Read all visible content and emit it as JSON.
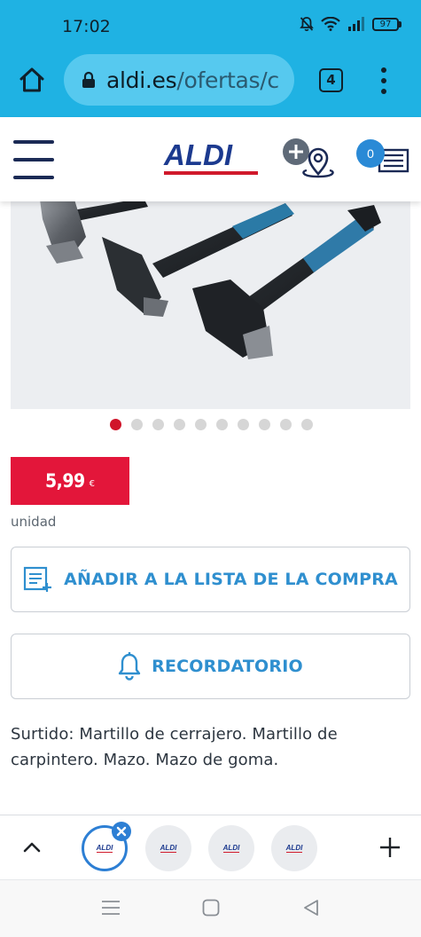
{
  "status_bar": {
    "time": "17:02",
    "battery": "97"
  },
  "browser": {
    "url_domain": "aldi.es",
    "url_path": "/ofertas/c",
    "tab_count": "4"
  },
  "header": {
    "logo_text": "ALDI",
    "list_count": "0"
  },
  "product": {
    "image_description": "Product photo: assorted hammers",
    "carousel": {
      "total": 10,
      "active_index": 0
    },
    "price": "5,99",
    "currency": "€",
    "unit": "unidad",
    "add_to_list_label": "AÑADIR A LA LISTA DE LA COMPRA",
    "reminder_label": "RECORDATORIO",
    "description": "Surtido: Martillo de cerrajero. Martillo de carpintero. Mazo. Mazo de goma."
  },
  "tab_strip": {
    "tabs": [
      {
        "label": "ALDI",
        "active": true
      },
      {
        "label": "ALDI",
        "active": false
      },
      {
        "label": "ALDI",
        "active": false
      },
      {
        "label": "ALDI",
        "active": false
      }
    ]
  },
  "icons": {
    "home": "home-icon",
    "lock": "lock-icon",
    "menu": "more-vert-icon",
    "hamburger": "hamburger-menu-icon",
    "store": "store-locator-icon",
    "list": "shopping-list-icon",
    "bell": "bell-icon",
    "chevron": "chevron-up-icon",
    "close": "close-icon",
    "plus": "plus-icon"
  },
  "colors": {
    "chrome_bg": "#1fb2e3",
    "brand_blue": "#1c3a8f",
    "brand_red": "#d0192b",
    "price_bg": "#e3163a",
    "action_blue": "#2f8fcf"
  }
}
